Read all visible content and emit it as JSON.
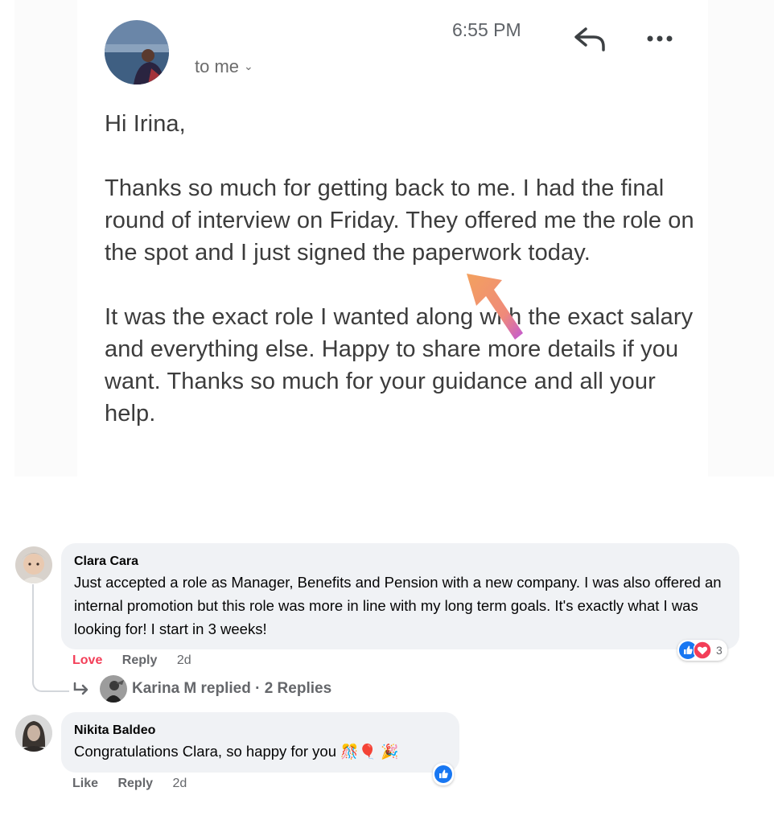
{
  "email": {
    "recipient_label": "to me",
    "time": "6:55 PM",
    "reply_icon": "reply-icon",
    "more_icon": "more-options-icon",
    "greeting": "Hi Irina,",
    "paragraph1": "Thanks so much for getting back to me. I had the final round of interview on Friday. They offered me the role on the spot and I just signed the paperwork today.",
    "paragraph2": "It was the exact role I wanted along with the exact salary and everything else. Happy to share more details if you want. Thanks so much for your guidance and all your help.",
    "annotation_color": "#f0a060"
  },
  "comments": [
    {
      "author": "Clara Cara",
      "text": "Just accepted a role as Manager, Benefits and Pension with a new company. I was also offered an internal promotion but this role was more in line with my long term goals. It's exactly what I was looking for! I start in 3 weeks!",
      "actions": {
        "react": "Love",
        "reply": "Reply",
        "time": "2d"
      },
      "reaction_count": "3",
      "reactions": [
        "like-icon",
        "love-icon"
      ],
      "replies_summary": "Karina M replied · 2 Replies"
    },
    {
      "author": "Nikita Baldeo",
      "text": "Congratulations Clara, so happy for you",
      "emojis": [
        "🎊",
        "🎈",
        "🎉"
      ],
      "actions": {
        "react": "Like",
        "reply": "Reply",
        "time": "2d"
      },
      "reactions": [
        "like-icon"
      ]
    }
  ],
  "colors": {
    "bubble": "#f0f2f5",
    "love": "#f33e58",
    "like": "#1877f2",
    "meta_text": "#65676b"
  }
}
